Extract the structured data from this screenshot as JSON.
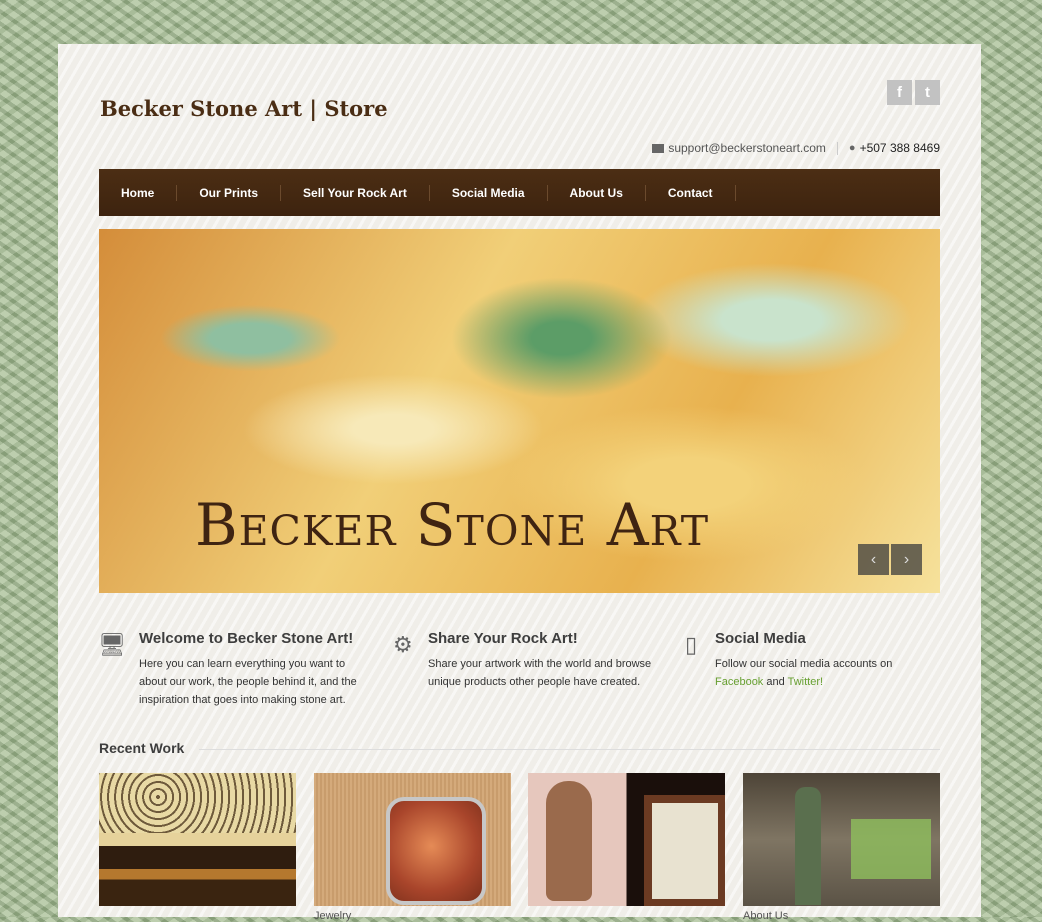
{
  "header": {
    "title": "Becker Stone Art | Store",
    "email": "support@beckerstoneart.com",
    "phone": "+507 388 8469",
    "social": [
      {
        "label": "f",
        "icon": "facebook-icon"
      },
      {
        "label": "t",
        "icon": "twitter-icon"
      }
    ]
  },
  "nav": {
    "items": [
      "Home",
      "Our Prints",
      "Sell Your Rock Art",
      "Social Media",
      "About Us",
      "Contact"
    ]
  },
  "hero": {
    "text": "Becker Stone Art",
    "prev": "‹",
    "next": "›"
  },
  "features": [
    {
      "icon": "monitor-icon",
      "title": "Welcome to Becker Stone Art!",
      "text": "Here you can learn everything you want to about our work, the people behind it, and the inspiration that goes into making stone art."
    },
    {
      "icon": "gear-icon",
      "title": "Share Your Rock Art!",
      "text": "Share your artwork with the world and browse unique products other people have created."
    },
    {
      "icon": "phone-icon",
      "title": "Social Media",
      "text": "Follow our social media accounts on",
      "link1": "Facebook",
      "and": "and",
      "link2": "Twitter!"
    }
  ],
  "recent_work": {
    "title": "Recent Work",
    "items": [
      {
        "label": ""
      },
      {
        "label": "Jewelry"
      },
      {
        "label": ""
      },
      {
        "label": "About Us"
      }
    ]
  },
  "colors": {
    "brand_brown": "#4a2d14",
    "nav_bg": "#3d230f",
    "link_green": "#68a032"
  }
}
